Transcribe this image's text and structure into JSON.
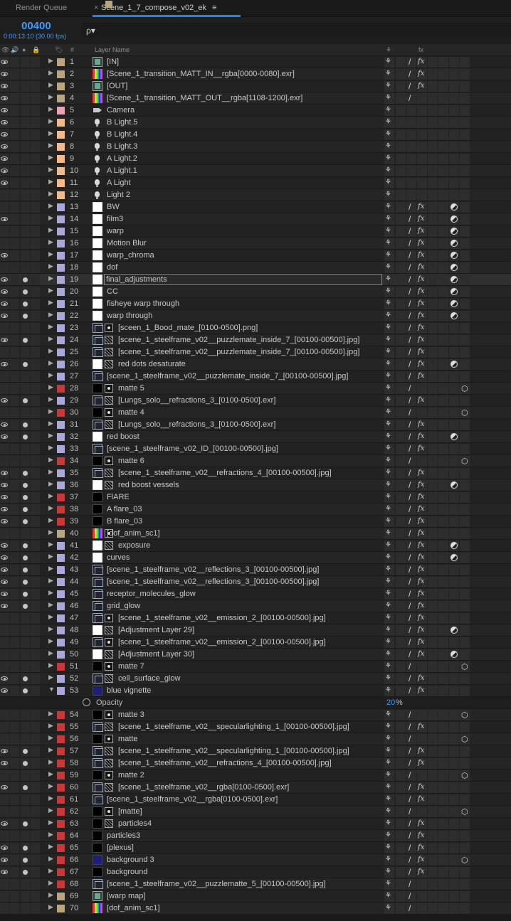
{
  "tabs": {
    "render_queue": "Render Queue",
    "close": "×",
    "comp": "Scene_1_7_compose_v02_ek",
    "menu": "≡"
  },
  "header": {
    "timecode": "00400",
    "timecode_sub": "0:00:13:10 (30.00 fps)",
    "search_icon": "ρ▾"
  },
  "columns": {
    "tag": "🏷",
    "num": "#",
    "layer_name": "Layer Name",
    "switch_shy": "⚘",
    "switch_fx": "fx"
  },
  "colors": {
    "beige": "#b9a57f",
    "pink": "#e7a3b4",
    "orange": "#f2b98c",
    "lilac": "#a9a8d7",
    "red": "#c33a3a",
    "peach": "#e5b58c",
    "accent": "#3d9bff"
  },
  "opacity": {
    "label": "Opacity",
    "value": "20",
    "unit": "%"
  },
  "layers": [
    {
      "n": "1",
      "name": "[IN]",
      "c": "beige",
      "icon": "footage",
      "eye": 1,
      "sw": "shy,slash,fx"
    },
    {
      "n": "2",
      "name": "[Scene_1_transition_MATT_IN__rgba[0000-0080].exr]",
      "c": "beige",
      "icon": "colorbar",
      "eye": 1,
      "sw": "shy,slash,fx"
    },
    {
      "n": "3",
      "name": "[OUT]",
      "c": "beige",
      "icon": "footage",
      "eye": 1,
      "sw": "shy,slash,fx"
    },
    {
      "n": "4",
      "name": "[Scene_1_transition_MATT_OUT__rgba[1108-1200].exr]",
      "c": "beige",
      "icon": "colorbar",
      "eye": 1,
      "sw": "shy,slash"
    },
    {
      "n": "5",
      "name": "Camera",
      "c": "pink",
      "icon": "cam",
      "eye": 1,
      "sw": "shy"
    },
    {
      "n": "6",
      "name": "B Light.5",
      "c": "orange",
      "icon": "light",
      "eye": 1,
      "sw": "shy"
    },
    {
      "n": "7",
      "name": "B Light.4",
      "c": "orange",
      "icon": "light",
      "eye": 1,
      "sw": "shy"
    },
    {
      "n": "8",
      "name": "B Light.3",
      "c": "orange",
      "icon": "light",
      "eye": 1,
      "sw": "shy"
    },
    {
      "n": "9",
      "name": "A Light.2",
      "c": "orange",
      "icon": "light",
      "eye": 1,
      "sw": "shy"
    },
    {
      "n": "10",
      "name": "A Light.1",
      "c": "orange",
      "icon": "light",
      "eye": 1,
      "sw": "shy"
    },
    {
      "n": "11",
      "name": "A Light",
      "c": "orange",
      "icon": "light",
      "eye": 1,
      "sw": "shy"
    },
    {
      "n": "12",
      "name": "Light 2",
      "c": "orange",
      "icon": "light",
      "eye": 0,
      "sw": "shy"
    },
    {
      "n": "13",
      "name": "BW",
      "c": "lilac",
      "icon": "solidwhite",
      "eye": 0,
      "sw": "shy,slash,fx,adj"
    },
    {
      "n": "14",
      "name": "film3",
      "c": "lilac",
      "icon": "solidwhite",
      "eye": 1,
      "sw": "shy,slash,fx,adj"
    },
    {
      "n": "15",
      "name": "warp",
      "c": "lilac",
      "icon": "solidwhite",
      "eye": 0,
      "sw": "shy,slash,fx,adj"
    },
    {
      "n": "16",
      "name": "Motion Blur",
      "c": "lilac",
      "icon": "solidwhite",
      "eye": 0,
      "sw": "shy,slash,fx,adj"
    },
    {
      "n": "17",
      "name": "warp_chroma",
      "c": "lilac",
      "icon": "solidwhite",
      "eye": 1,
      "sw": "shy,slash,fx,adj"
    },
    {
      "n": "18",
      "name": "dof",
      "c": "lilac",
      "icon": "solidwhite",
      "eye": 0,
      "sw": "shy,slash,fx,adj"
    },
    {
      "n": "19",
      "name": "final_adjustments",
      "c": "lilac",
      "icon": "solidwhite",
      "eye": 1,
      "solo": 1,
      "sw": "shy,slash,fx,adj",
      "sel": 1
    },
    {
      "n": "20",
      "name": "CC",
      "c": "lilac",
      "icon": "solidwhite",
      "eye": 1,
      "solo": 1,
      "sw": "shy,slash,fx,adj"
    },
    {
      "n": "21",
      "name": "fisheye warp through",
      "c": "lilac",
      "icon": "solidwhite",
      "eye": 1,
      "solo": 1,
      "sw": "shy,slash,fx,adj"
    },
    {
      "n": "22",
      "name": "warp through",
      "c": "lilac",
      "icon": "solidwhite",
      "eye": 1,
      "solo": 1,
      "sw": "shy,slash,fx,adj"
    },
    {
      "n": "23",
      "name": "[sceen_1_Bood_mate_[0100-0500].png]",
      "c": "lilac",
      "icon": "seq",
      "mi": "dot",
      "shift": 1,
      "eye": 0,
      "sw": "shy,slash,fx"
    },
    {
      "n": "24",
      "name": "[scene_1_steelframe_v02__puzzlemate_inside_7_[00100-00500].jpg]",
      "c": "lilac",
      "icon": "seq",
      "mi": "mesh",
      "shift": 1,
      "eye": 1,
      "solo": 1,
      "sw": "shy,slash,fx"
    },
    {
      "n": "25",
      "name": "[scene_1_steelframe_v02__puzzlemate_inside_7_[00100-00500].jpg]",
      "c": "lilac",
      "icon": "seq",
      "mi": "mesh",
      "shift": 1,
      "eye": 0,
      "sw": "shy,slash,fx"
    },
    {
      "n": "26",
      "name": "red dots desaturate",
      "c": "lilac",
      "icon": "solidwhite",
      "mi": "mesh",
      "shift": 1,
      "eye": 1,
      "solo": 1,
      "sw": "shy,slash,fx,adj"
    },
    {
      "n": "27",
      "name": "[scene_1_steelframe_v02__puzzlemate_inside_7_[00100-00500].jpg]",
      "c": "lilac",
      "icon": "seq",
      "eye": 0,
      "sw": "shy,slash,fx"
    },
    {
      "n": "28",
      "name": "matte 5",
      "c": "red",
      "icon": "solidblack",
      "mi": "dot",
      "shift": 1,
      "eye": 0,
      "sw": "shy,slash,cube"
    },
    {
      "n": "29",
      "name": "[Lungs_solo__refractions_3_[0100-0500].exr]",
      "c": "lilac",
      "icon": "seq",
      "mi": "mesh",
      "shift": 1,
      "eye": 1,
      "solo": 1,
      "sw": "shy,slash,fx"
    },
    {
      "n": "30",
      "name": "matte 4",
      "c": "red",
      "icon": "solidblack",
      "mi": "dot",
      "shift": 1,
      "eye": 0,
      "sw": "shy,slash,cube"
    },
    {
      "n": "31",
      "name": "[Lungs_solo__refractions_3_[0100-0500].exr]",
      "c": "lilac",
      "icon": "seq",
      "mi": "mesh",
      "shift": 1,
      "eye": 1,
      "solo": 1,
      "sw": "shy,slash,fx"
    },
    {
      "n": "32",
      "name": "red boost",
      "c": "lilac",
      "icon": "solidwhite",
      "eye": 1,
      "solo": 1,
      "sw": "shy,slash,fx,adj"
    },
    {
      "n": "33",
      "name": "[scene_1_steelframe_v02_ID_[00100-00500].jpg]",
      "c": "lilac",
      "icon": "seq",
      "eye": 0,
      "sw": "shy,slash,fx"
    },
    {
      "n": "34",
      "name": "matte 6",
      "c": "red",
      "icon": "solidblack",
      "mi": "dot",
      "shift": 1,
      "eye": 0,
      "sw": "shy,slash,cube"
    },
    {
      "n": "35",
      "name": "[scene_1_steelframe_v02__refractions_4_[00100-00500].jpg]",
      "c": "lilac",
      "icon": "seq",
      "mi": "mesh",
      "shift": 1,
      "eye": 1,
      "solo": 1,
      "sw": "shy,slash,fx"
    },
    {
      "n": "36",
      "name": "red boost vessels",
      "c": "lilac",
      "icon": "solidwhite",
      "mi": "mesh",
      "shift": 1,
      "eye": 1,
      "solo": 1,
      "sw": "shy,slash,fx,adj"
    },
    {
      "n": "37",
      "name": "FlARE",
      "c": "red",
      "icon": "solidblack",
      "eye": 1,
      "solo": 1,
      "sw": "shy,slash,fx"
    },
    {
      "n": "38",
      "name": "A flare_03",
      "c": "red",
      "icon": "solidblack",
      "eye": 1,
      "solo": 1,
      "sw": "shy,slash,fx"
    },
    {
      "n": "39",
      "name": "B flare_03",
      "c": "red",
      "icon": "solidblack",
      "eye": 1,
      "solo": 1,
      "sw": "shy,slash,fx"
    },
    {
      "n": "40",
      "name": "[dof_anim_sc1]",
      "c": "beige",
      "icon": "colorbar",
      "mi": "dot",
      "eye": 0,
      "sw": "shy,slash,fx"
    },
    {
      "n": "41",
      "name": "exposure",
      "c": "lilac",
      "icon": "solidwhite",
      "mi": "mesh",
      "shift": 1,
      "eye": 1,
      "solo": 1,
      "sw": "shy,slash,fx,adj"
    },
    {
      "n": "42",
      "name": "curves",
      "c": "lilac",
      "icon": "solidwhite",
      "eye": 1,
      "solo": 1,
      "sw": "shy,slash,fx,adj"
    },
    {
      "n": "43",
      "name": "[scene_1_steelframe_v02__reflections_3_[00100-00500].jpg]",
      "c": "lilac",
      "icon": "seq",
      "eye": 1,
      "solo": 1,
      "sw": "shy,slash,fx"
    },
    {
      "n": "44",
      "name": "[scene_1_steelframe_v02__reflections_3_[00100-00500].jpg]",
      "c": "lilac",
      "icon": "seq",
      "eye": 1,
      "solo": 1,
      "sw": "shy,slash,fx"
    },
    {
      "n": "45",
      "name": "receptor_molecules_glow",
      "c": "lilac",
      "icon": "seq",
      "eye": 1,
      "solo": 1,
      "sw": "shy,slash,fx"
    },
    {
      "n": "46",
      "name": "grid_glow",
      "c": "lilac",
      "icon": "seq",
      "eye": 1,
      "solo": 1,
      "sw": "shy,slash,fx"
    },
    {
      "n": "47",
      "name": "[scene_1_steelframe_v02__emission_2_[00100-00500].jpg]",
      "c": "lilac",
      "icon": "seq",
      "mi": "dot",
      "shift": 1,
      "eye": 0,
      "sw": "shy,slash,fx"
    },
    {
      "n": "48",
      "name": "[Adjustment Layer 29]",
      "c": "lilac",
      "icon": "solidwhite",
      "mi": "mesh",
      "shift": 1,
      "eye": 0,
      "sw": "shy,slash,fx,adj"
    },
    {
      "n": "49",
      "name": "[scene_1_steelframe_v02__emission_2_[00100-00500].jpg]",
      "c": "lilac",
      "icon": "seq",
      "mi": "dot",
      "shift": 1,
      "eye": 0,
      "sw": "shy,slash,fx"
    },
    {
      "n": "50",
      "name": "[Adjustment Layer 30]",
      "c": "lilac",
      "icon": "solidwhite",
      "mi": "mesh",
      "shift": 1,
      "eye": 0,
      "sw": "shy,slash,fx,adj"
    },
    {
      "n": "51",
      "name": "matte 7",
      "c": "red",
      "icon": "solidblack",
      "mi": "dot",
      "shift": 1,
      "eye": 0,
      "sw": "shy,slash,cube"
    },
    {
      "n": "52",
      "name": "cell_surface_glow",
      "c": "lilac",
      "icon": "seq",
      "mi": "mesh",
      "shift": 1,
      "eye": 1,
      "solo": 1,
      "sw": "shy,slash,fx"
    },
    {
      "n": "53",
      "name": "blue vignette",
      "c": "lilac",
      "icon": "solidblue",
      "eye": 1,
      "solo": 1,
      "sw": "shy,slash,fx",
      "open": 1
    },
    {
      "n": "54",
      "name": "matte 3",
      "c": "red",
      "icon": "solidblack",
      "mi": "dot",
      "shift": 1,
      "eye": 0,
      "sw": "shy,slash,cube"
    },
    {
      "n": "55",
      "name": "[scene_1_steelframe_v02__specularlighting_1_[00100-00500].jpg]",
      "c": "red",
      "icon": "seq",
      "mi": "mesh",
      "shift": 1,
      "eye": 0,
      "sw": "shy,slash,fx"
    },
    {
      "n": "56",
      "name": "matte",
      "c": "red",
      "icon": "solidblack",
      "mi": "dot",
      "shift": 1,
      "eye": 0,
      "sw": "shy,slash,cube"
    },
    {
      "n": "57",
      "name": "[scene_1_steelframe_v02__specularlighting_1_[00100-00500].jpg]",
      "c": "red",
      "icon": "seq",
      "mi": "mesh",
      "shift": 1,
      "eye": 1,
      "solo": 1,
      "sw": "shy,slash,fx"
    },
    {
      "n": "58",
      "name": "[scene_1_steelframe_v02__refractions_4_[00100-00500].jpg]",
      "c": "red",
      "icon": "seq",
      "mi": "mesh",
      "shift": 1,
      "eye": 1,
      "solo": 1,
      "sw": "shy,slash,fx"
    },
    {
      "n": "59",
      "name": "matte 2",
      "c": "red",
      "icon": "solidblack",
      "mi": "dot",
      "shift": 1,
      "eye": 0,
      "sw": "shy,slash,cube"
    },
    {
      "n": "60",
      "name": "[scene_1_steelframe_v02__rgba[0100-0500].exr]",
      "c": "red",
      "icon": "seq",
      "mi": "mesh",
      "shift": 1,
      "eye": 1,
      "solo": 1,
      "sw": "shy,slash,fx"
    },
    {
      "n": "61",
      "name": "[scene_1_steelframe_v02__rgba[0100-0500].exr]",
      "c": "red",
      "icon": "seq",
      "eye": 0,
      "sw": "shy,slash,fx"
    },
    {
      "n": "62",
      "name": "[matte]",
      "c": "red",
      "icon": "solidblack",
      "mi": "dot",
      "shift": 1,
      "eye": 0,
      "sw": "shy,slash,cube"
    },
    {
      "n": "63",
      "name": "particles4",
      "c": "red",
      "icon": "solidblack",
      "mi": "mesh",
      "shift": 1,
      "eye": 1,
      "solo": 1,
      "sw": "shy,slash,fx"
    },
    {
      "n": "64",
      "name": "particles3",
      "c": "red",
      "icon": "solidblack",
      "eye": 0,
      "sw": "shy,slash,fx"
    },
    {
      "n": "65",
      "name": "[plexus]",
      "c": "red",
      "icon": "solidblack",
      "eye": 1,
      "solo": 1,
      "sw": "shy,slash,fx"
    },
    {
      "n": "66",
      "name": "background 3",
      "c": "red",
      "icon": "solidblue",
      "eye": 1,
      "solo": 1,
      "sw": "shy,slash,fx,cube"
    },
    {
      "n": "67",
      "name": "background",
      "c": "red",
      "icon": "solidblack",
      "eye": 1,
      "solo": 1,
      "sw": "shy,slash,fx"
    },
    {
      "n": "68",
      "name": "[scene_1_steelframe_v02__puzzlematte_5_[00100-00500].jpg]",
      "c": "red",
      "icon": "seq",
      "eye": 0,
      "sw": "shy,slash"
    },
    {
      "n": "69",
      "name": "[warp map]",
      "c": "beige",
      "icon": "footage",
      "eye": 0,
      "sw": "shy,slash"
    },
    {
      "n": "70",
      "name": "[dof_anim_sc1]",
      "c": "beige",
      "icon": "colorbar",
      "eye": 0,
      "sw": "shy,slash"
    }
  ]
}
